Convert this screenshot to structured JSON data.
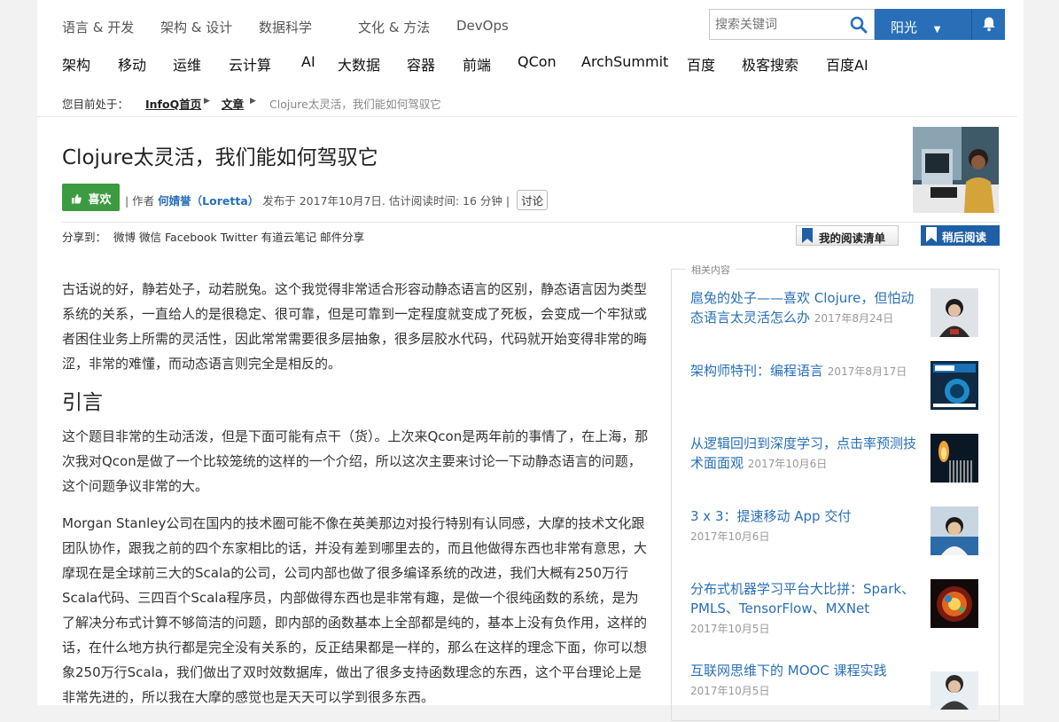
{
  "topnav": {
    "items": [
      "语言 & 开发",
      "架构 & 设计",
      "数据科学",
      "文化 & 方法",
      "DevOps"
    ]
  },
  "search": {
    "placeholder": "搜索关键词"
  },
  "user": {
    "name": "阳光"
  },
  "catnav": {
    "items": [
      "架构",
      "移动",
      "运维",
      "云计算",
      "AI",
      "大数据",
      "容器",
      "前端",
      "QCon",
      "ArchSummit",
      "百度",
      "极客搜索",
      "百度AI"
    ]
  },
  "breadcrumb": {
    "prefix": "您目前处于：",
    "home": "InfoQ首页",
    "section": "文章",
    "current": "Clojure太灵活，我们能如何驾驭它"
  },
  "article": {
    "title": "Clojure太灵活，我们能如何驾驭它",
    "like_label": "喜欢",
    "by_label": "| 作者",
    "author": "何婧誉（Loretta）",
    "published": "发布于 2017年10月7日. 估计阅读时间: 16 分钟 |",
    "discuss_label": "讨论",
    "share_label": "分享到：",
    "share_targets": [
      "微博",
      "微信",
      "Facebook",
      "Twitter",
      "有道云笔记",
      "邮件分享"
    ],
    "readlist_label": "我的阅读清单",
    "readlater_label": "稍后阅读",
    "paragraphs": [
      "古话说的好，静若处子，动若脱兔。这个我觉得非常适合形容动静态语言的区别，静态语言因为类型系统的关系，一直给人的是很稳定、很可靠，但是可靠到一定程度就变成了死板，会变成一个牢狱或者困住业务上所需的灵活性，因此常常需要很多层抽象，很多层胶水代码，代码就开始变得非常的晦涩，非常的难懂，而动态语言则完全是相反的。",
      "这个题目非常的生动活泼，但是下面可能有点干（货）。上次来Qcon是两年前的事情了，在上海，那次我对Qcon是做了一个比较笼统的这样的一个介绍，所以这次主要来讨论一下动静态语言的问题，这个问题争议非常的大。",
      "Morgan Stanley公司在国内的技术圈可能不像在英美那边对投行特别有认同感，大摩的技术文化跟团队协作，跟我之前的四个东家相比的话，并没有差到哪里去的，而且他做得东西也非常有意思，大摩现在是全球前三大的Scala的公司，公司内部也做了很多编译系统的改进，我们大概有250万行Scala代码、三四百个Scala程序员，内部做得东西也是非常有趣，是做一个很纯函数的系统，是为了解决分布式计算不够简洁的问题，即内部的函数基本上全部都是纯的，基本上没有负作用，这样的话，在什么地方执行都是完全没有关系的，反正结果都是一样的，那么在这样的理念下面，你可以想象250万行Scala，我们做出了双时效数据库，做出了很多支持函数理念的东西，这个平台理论上是非常先进的，所以我在大摩的感觉也是天天可以学到很多东西。"
    ],
    "heading": "引言"
  },
  "related": {
    "legend": "相关内容",
    "items": [
      {
        "title": "扈兔的处子——喜欢 Clojure，但怕动态语言太灵活怎么办",
        "date": "2017年8月24日"
      },
      {
        "title": "架构师特刊：编程语言",
        "date": "2017年8月17日"
      },
      {
        "title": "从逻辑回归到深度学习，点击率预测技术面面观",
        "date": "2017年10月6日"
      },
      {
        "title": "3 x 3：提速移动 App 交付",
        "date": "2017年10月6日"
      },
      {
        "title": "分布式机器学习平台大比拼：Spark、PMLS、TensorFlow、MXNet",
        "date": "2017年10月5日"
      },
      {
        "title": "互联网思维下的 MOOC 课程实践",
        "date": "2017年10月5日"
      }
    ]
  },
  "colors": {
    "accent": "#286fb8",
    "like": "#3c9a40",
    "readlater": "#1f5fa6"
  }
}
